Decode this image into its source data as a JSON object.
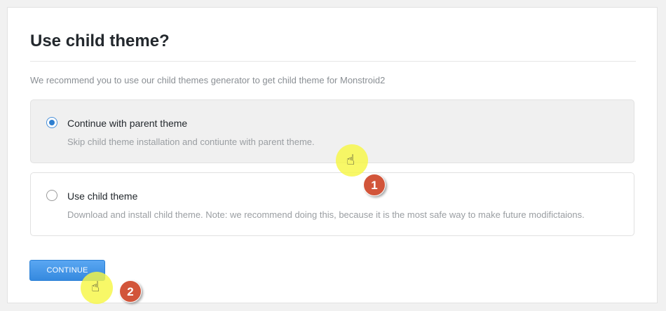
{
  "wizard": {
    "title": "Use child theme?",
    "intro": "We recommend you to use our child themes generator to get child theme for Monstroid2",
    "options": [
      {
        "label": "Continue with parent theme",
        "description": "Skip child theme installation and contiunte with parent theme.",
        "selected": true
      },
      {
        "label": "Use child theme",
        "description": "Download and install child theme. Note: we recommend doing this, because it is the most safe way to make future modifictaions.",
        "selected": false
      }
    ],
    "continue_label": "CONTINUE"
  },
  "annotations": [
    {
      "number": "1",
      "icon": "hand-pointer-icon"
    },
    {
      "number": "2",
      "icon": "hand-pointer-icon"
    }
  ],
  "colors": {
    "primary_button": "#3589df",
    "highlight": "#f6f646",
    "badge": "#d2553a",
    "radio_checked": "#2f7fd0"
  }
}
